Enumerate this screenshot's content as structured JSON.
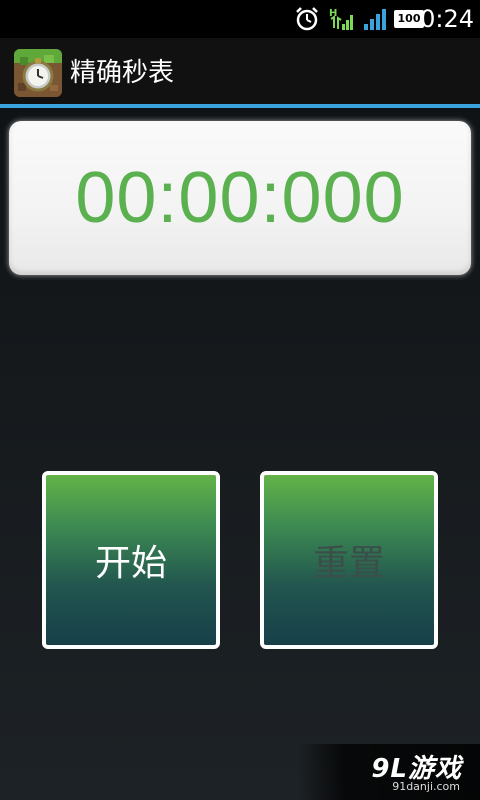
{
  "status_bar": {
    "time": "0:24",
    "battery": "100",
    "icons": [
      "alarm-icon",
      "data-h-icon",
      "signal-icon",
      "battery-icon"
    ]
  },
  "action_bar": {
    "title": "精确秒表",
    "app_icon": "stopwatch-app-icon",
    "divider_color": "#3aa2dc"
  },
  "timer": {
    "display": "00:00:000",
    "color": "#5bb14f"
  },
  "buttons": {
    "start_label": "开始",
    "reset_label": "重置"
  },
  "watermark": {
    "logo": "9L游戏",
    "url": "91danji.com"
  }
}
